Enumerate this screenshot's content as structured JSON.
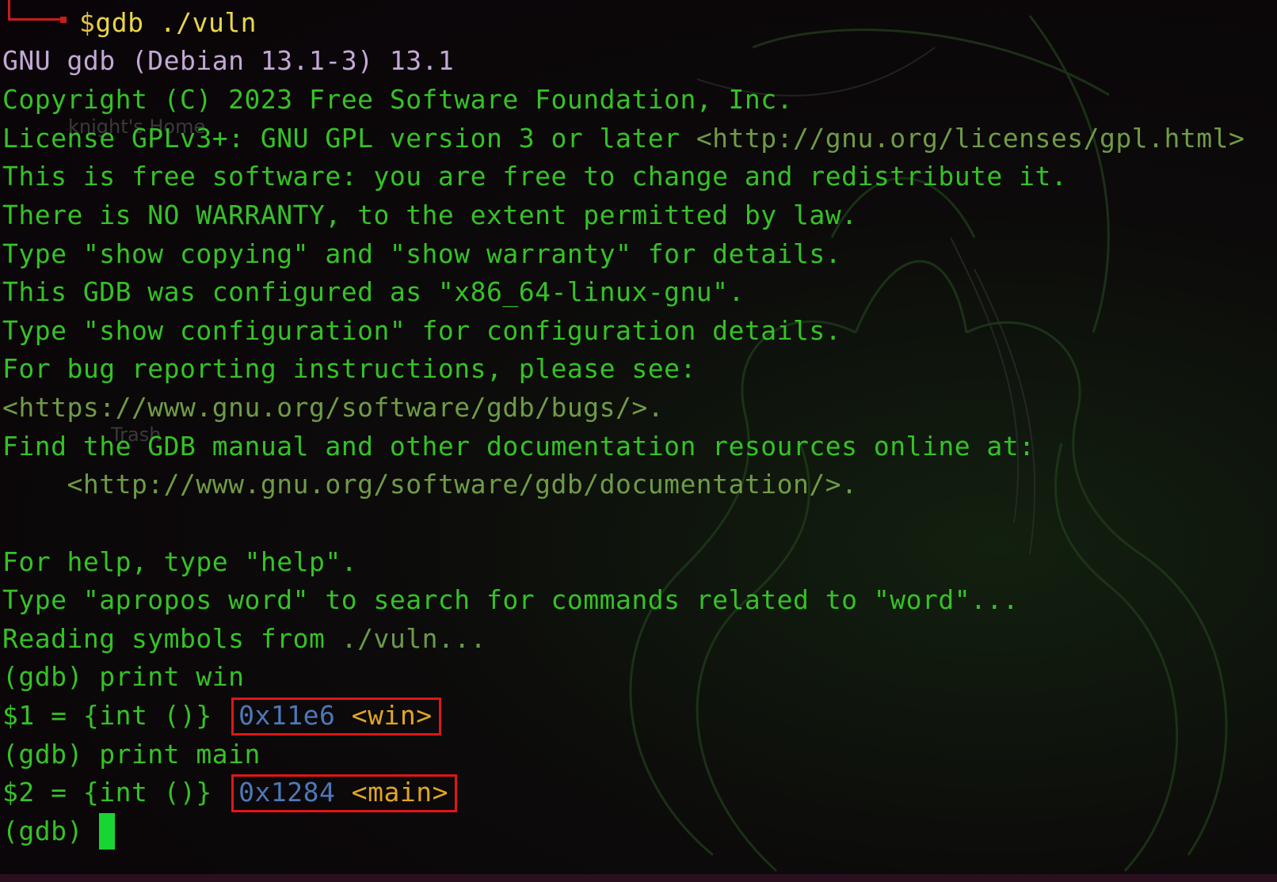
{
  "terminal": {
    "command_prefix": "$",
    "command": "gdb ./vuln",
    "gdb_version": "GNU gdb (Debian 13.1-3) 13.1",
    "copyright": "Copyright (C) 2023 Free Software Foundation, Inc.",
    "license_prefix": "License GPLv3+: GNU GPL version 3 or later ",
    "license_url": "<http://gnu.org/licenses/gpl.html>",
    "free_software": "This is free software: you are free to change and redistribute it.",
    "warranty": "There is NO WARRANTY, to the extent permitted by law.",
    "show_copying": "Type \"show copying\" and \"show warranty\" for details.",
    "configured": "This GDB was configured as \"x86_64-linux-gnu\".",
    "show_config": "Type \"show configuration\" for configuration details.",
    "bug_reporting": "For bug reporting instructions, please see:",
    "bugs_url": "<https://www.gnu.org/software/gdb/bugs/>.",
    "manual": "Find the GDB manual and other documentation resources online at:",
    "doc_url": "    <http://www.gnu.org/software/gdb/documentation/>.",
    "help": "For help, type \"help\".",
    "apropos": "Type \"apropos word\" to search for commands related to \"word\"...",
    "reading_prefix": "Reading symbols from ",
    "reading_file": "./vuln...",
    "cmd1": "(gdb) print win",
    "result1_prefix": "$1 = {int ()} ",
    "result1_addr": "0x11e6",
    "result1_sym": "<win>",
    "cmd2": "(gdb) print main",
    "result2_prefix": "$2 = {int ()} ",
    "result2_addr": "0x1284",
    "result2_sym": "<main>",
    "prompt": "(gdb) "
  },
  "desktop": {
    "home_icon_label": "knight's Home",
    "trash_icon_label": "Trash"
  },
  "colors": {
    "text": "#35c227",
    "prompt_symbol": "#e3c04a",
    "address": "#4d78b8",
    "symbol": "#e0a625",
    "highlight_box": "#e11616",
    "cursor": "#18d632"
  }
}
